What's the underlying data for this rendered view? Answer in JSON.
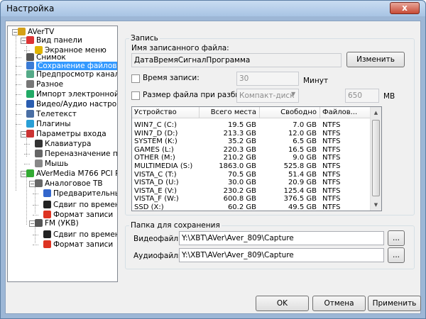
{
  "window": {
    "title": "Настройка",
    "close": "x"
  },
  "tree": {
    "items": [
      {
        "label": "AVerTV",
        "icon_color": "#d4a017",
        "icon": "app-icon"
      },
      {
        "label": "Вид панели",
        "icon_color": "#d33",
        "icon": "panel-view-icon"
      },
      {
        "label": "Экранное меню",
        "icon_color": "#e0b400",
        "icon": "osd-menu-icon"
      },
      {
        "label": "Снимок",
        "icon_color": "#555",
        "icon": "snapshot-icon"
      },
      {
        "label": "Сохранение файлов",
        "icon_color": "#3a7bd5",
        "icon": "save-files-icon"
      },
      {
        "label": "Предпросмотр каналов",
        "icon_color": "#5a8",
        "icon": "channel-preview-icon"
      },
      {
        "label": "Разное",
        "icon_color": "#777",
        "icon": "misc-icon"
      },
      {
        "label": "Импорт электронной прог",
        "icon_color": "#2a6",
        "icon": "epg-import-icon"
      },
      {
        "label": "Видео/Аудио настройки",
        "icon_color": "#2a5db0",
        "icon": "video-audio-icon"
      },
      {
        "label": "Телетекст",
        "icon_color": "#4a6fa5",
        "icon": "teletext-icon"
      },
      {
        "label": "Плагины",
        "icon_color": "#2a9fd6",
        "icon": "plugins-icon"
      },
      {
        "label": "Параметры входа",
        "icon_color": "#c33",
        "icon": "input-params-icon"
      },
      {
        "label": "Клавиатура",
        "icon_color": "#333",
        "icon": "keyboard-icon"
      },
      {
        "label": "Переназначение пульт",
        "icon_color": "#666",
        "icon": "remote-remap-icon"
      },
      {
        "label": "Мышь",
        "icon_color": "#888",
        "icon": "mouse-icon"
      },
      {
        "label": "AVerMedia M766 PCI Pure A",
        "icon_color": "#3a3",
        "icon": "tuner-card-icon"
      },
      {
        "label": "Аналоговое ТВ",
        "icon_color": "#666",
        "icon": "analog-tv-icon"
      },
      {
        "label": "Предварительный",
        "icon_color": "#3366cc",
        "icon": "preview-checklist-icon"
      },
      {
        "label": "Сдвиг по времени",
        "icon_color": "#222",
        "icon": "timeshift-icon"
      },
      {
        "label": "Формат записи",
        "icon_color": "#d32",
        "icon": "record-format-icon"
      },
      {
        "label": "FM (УКВ)",
        "icon_color": "#555",
        "icon": "fm-radio-icon"
      },
      {
        "label": "Сдвиг по времени",
        "icon_color": "#222",
        "icon": "fm-timeshift-icon"
      },
      {
        "label": "Формат записи",
        "icon_color": "#d32",
        "icon": "fm-record-format-icon"
      }
    ]
  },
  "record": {
    "group_title": "Запись",
    "filename_label": "Имя записанного файла:",
    "filename_value": "ДатаВремяСигналПрограмма",
    "change_button": "Изменить",
    "record_time_label": "Время записи:",
    "record_time_value": "30",
    "minutes_unit": "Минут",
    "split_label": "Размер файла при разбиении:",
    "split_preset": "Компакт-диск",
    "split_value": "650",
    "split_unit": "MB"
  },
  "drives": {
    "columns": [
      "Устройство",
      "Всего места",
      "Свободно",
      "Файлов..."
    ],
    "rows": [
      [
        "WIN7_C (C:)",
        "19.5 GB",
        "7.0 GB",
        "NTFS"
      ],
      [
        "WIN7_D (D:)",
        "213.3 GB",
        "12.0 GB",
        "NTFS"
      ],
      [
        "SYSTEM (K:)",
        "35.2 GB",
        "6.5 GB",
        "NTFS"
      ],
      [
        "GAMES (L:)",
        "220.3 GB",
        "16.5 GB",
        "NTFS"
      ],
      [
        "OTHER (M:)",
        "210.2 GB",
        "9.0 GB",
        "NTFS"
      ],
      [
        "MULTIMEDIA (S:)",
        "1863.0 GB",
        "525.8 GB",
        "NTFS"
      ],
      [
        "VISTA_C (T:)",
        "70.5 GB",
        "51.4 GB",
        "NTFS"
      ],
      [
        "VISTA_D (U:)",
        "30.0 GB",
        "20.9 GB",
        "NTFS"
      ],
      [
        "VISTA_E (V:)",
        "230.2 GB",
        "125.4 GB",
        "NTFS"
      ],
      [
        "VISTA_F (W:)",
        "600.8 GB",
        "376.5 GB",
        "NTFS"
      ],
      [
        "SSD (X:)",
        "60.2 GB",
        "49.5 GB",
        "NTFS"
      ]
    ]
  },
  "folder": {
    "group_title": "Папка для сохранения",
    "video_label": "Видеофайлы:",
    "video_path": "Y:\\XBT\\AVer\\Aver_809\\Capture",
    "audio_label": "Аудиофайлы:",
    "audio_path": "Y:\\XBT\\AVer\\Aver_809\\Capture",
    "browse": "..."
  },
  "buttons": {
    "ok": "OK",
    "cancel": "Отмена",
    "apply": "Применить"
  }
}
